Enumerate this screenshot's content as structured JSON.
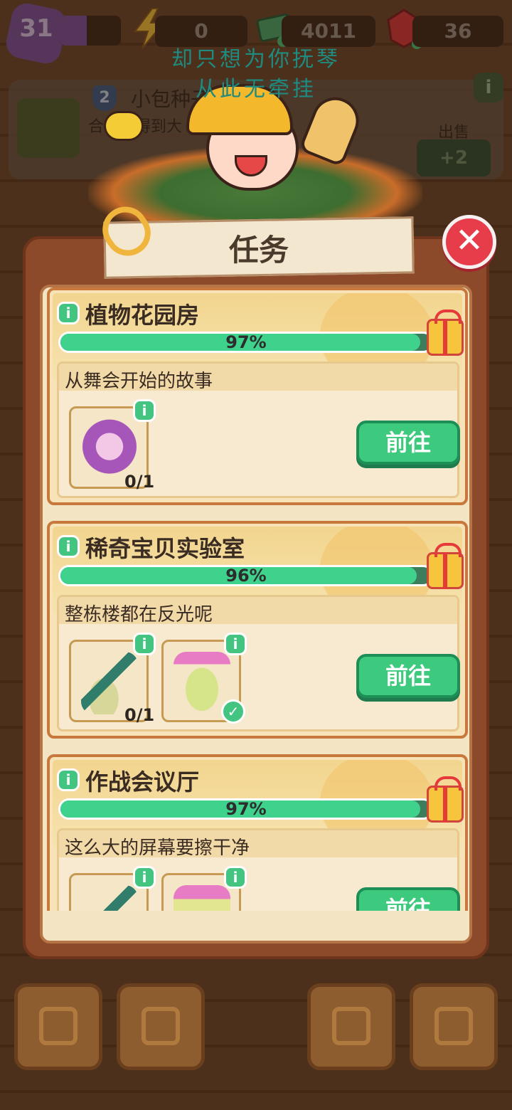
{
  "hud": {
    "level": "31",
    "energy": "0",
    "money": "4011",
    "gems": "36"
  },
  "subtitle": {
    "line1": "却只想为你抚琴",
    "line2": "从此无牵挂"
  },
  "background_panel": {
    "title": "小包种子",
    "subtitle": "合",
    "sub_suffix": "得到大",
    "badge": "2",
    "sell_label": "出售",
    "sell_value": "+2",
    "info": "i"
  },
  "dialog": {
    "title": "任务",
    "close": "✕"
  },
  "tasks": [
    {
      "title": "植物花园房",
      "progress_label": "97%",
      "progress": 0.97,
      "quest": "从舞会开始的故事",
      "items": [
        {
          "icon": "perfume-bottle-icon",
          "count": "0/1",
          "done": false
        }
      ],
      "go_label": "前往"
    },
    {
      "title": "稀奇宝贝实验室",
      "progress_label": "96%",
      "progress": 0.96,
      "quest": "整栋楼都在反光呢",
      "items": [
        {
          "icon": "mop-icon",
          "count": "0/1",
          "done": false
        },
        {
          "icon": "cleaner-bottle-icon",
          "count": "",
          "done": true
        }
      ],
      "go_label": "前往"
    },
    {
      "title": "作战会议厅",
      "progress_label": "97%",
      "progress": 0.97,
      "quest": "这么大的屏幕要擦干净",
      "items": [
        {
          "icon": "mop-icon",
          "count": "",
          "done": false
        },
        {
          "icon": "detergent-bottle-icon",
          "count": "",
          "done": false
        }
      ],
      "go_label": "前往"
    }
  ],
  "colors": {
    "progress_fill": "#3fd28c",
    "go_button": "#3dca7e",
    "close_button": "#e73c4a",
    "dialog_frame": "#8d4a2a"
  }
}
